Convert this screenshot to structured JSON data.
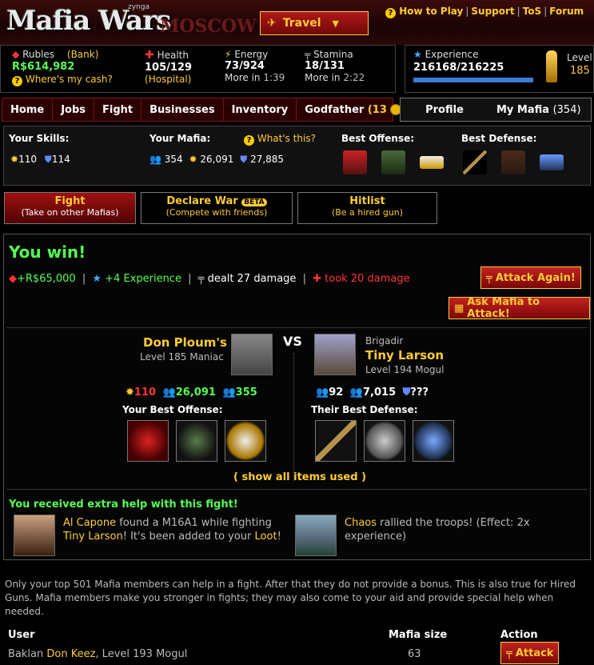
{
  "header": {
    "logo": "Mafia Wars",
    "logo_brand": "zynga",
    "city": "MOSCOW",
    "travel_label": "Travel",
    "links": [
      "How to Play",
      "Support",
      "ToS",
      "Forum"
    ]
  },
  "stats": {
    "currency_label": "Rubles",
    "bank_label": "(Bank)",
    "currency_value": "R$614,982",
    "cash_help": "Where's my cash?",
    "health_label": "Health",
    "health_value": "105/129",
    "hospital_label": "Hospital",
    "energy_label": "Energy",
    "energy_value": "73/924",
    "energy_more_label": "More in",
    "energy_more_time": "1:39",
    "stamina_label": "Stamina",
    "stamina_value": "18/131",
    "stamina_more_label": "More in",
    "stamina_more_time": "2:22",
    "experience_label": "Experience",
    "experience_value": "216168/216225",
    "experience_fraction": 0.9997,
    "level_label": "Level",
    "level_value": "185"
  },
  "nav": {
    "items": [
      "Home",
      "Jobs",
      "Fight",
      "Businesses",
      "Inventory",
      "Godfather"
    ],
    "godfather_count": "(13",
    "godfather_close": ")",
    "profile": "Profile",
    "my_mafia": "My Mafia",
    "my_mafia_count": "(354)"
  },
  "skills": {
    "skills_label": "Your Skills:",
    "attack": "110",
    "defense": "114",
    "mafia_label": "Your Mafia:",
    "whats_this": "What's this?",
    "mafia_size": "354",
    "mafia_attack": "26,091",
    "mafia_defense": "27,885",
    "best_offense_label": "Best Offense:",
    "best_defense_label": "Best Defense:"
  },
  "tabs": [
    {
      "title": "Fight",
      "subtitle": "(Take on other Mafias)"
    },
    {
      "title": "Declare War",
      "badge": "BETA",
      "subtitle": "(Compete with friends)"
    },
    {
      "title": "Hitlist",
      "subtitle": "(Be a hired gun)"
    }
  ],
  "fight": {
    "result": "You win!",
    "gain_cash": "+R$65,000",
    "gain_exp": "+4 Experience",
    "dealt": "dealt 27 damage",
    "took": "took 20 damage",
    "attack_again": "Attack Again!",
    "ask_mafia": "Ask Mafia to Attack!",
    "vs": "VS",
    "player": {
      "name": "Don Ploum's",
      "level": "Level 185 Maniac",
      "attack": "110",
      "mafia_attack": "26,091",
      "mafia_size": "355",
      "best_label": "Your Best Offense:"
    },
    "opponent": {
      "rank": "Brigadir",
      "name": "Tiny Larson",
      "level": "Level 194 Mogul",
      "mafia_size": "92",
      "mafia_defense": "7,015",
      "defense": "???",
      "best_label": "Their Best Defense:"
    },
    "show_all": "( show all items used )",
    "extra_help_title": "You received extra help with this fight!",
    "help1": {
      "name": "Al Capone",
      "text1": " found a M16A1 while fighting ",
      "target": "Tiny Larson",
      "text2": "! It's been added to your ",
      "loot": "Loot",
      "text3": "!"
    },
    "help2": {
      "name": "Chaos",
      "text": " rallied the troops! (Effect: 2x experience)"
    }
  },
  "info_text": "Only your top 501 Mafia members can help in a fight. After that they do not provide a bonus. This is also true for Hired Guns. Mafia members make you stronger in fights; they may also come to your aid and provide special help when needed.",
  "table": {
    "headers": [
      "User",
      "Mafia size",
      "Action"
    ],
    "rows": [
      {
        "rank": "Baklan",
        "name": "Don Keez",
        "level": ", Level 193 Mogul",
        "size": "63",
        "action": "Attack"
      }
    ]
  },
  "colors": {
    "accent": "#ffcc33",
    "win_green": "#55ff55",
    "damage_red": "#ff3333",
    "button_red": "#b01818"
  }
}
